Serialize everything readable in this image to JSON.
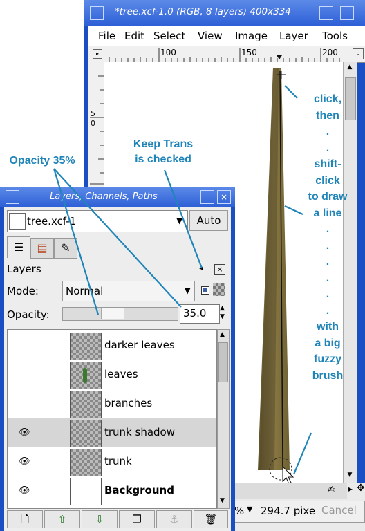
{
  "image_window": {
    "title": "*tree.xcf-1.0 (RGB, 8 layers) 400x334",
    "menu": [
      "File",
      "Edit",
      "Select",
      "View",
      "Image",
      "Layer",
      "Tools"
    ],
    "ruler_labels": [
      "100",
      "150",
      "200"
    ],
    "vruler_labels": [
      "5",
      "0"
    ],
    "zoom_value": "%",
    "coord_readout": "294.7 pixe",
    "cancel_label": "Cancel"
  },
  "layers_dialog": {
    "title": "Layers, Channels, Paths",
    "image_select": "tree.xcf-1",
    "auto_label": "Auto",
    "section_label": "Layers",
    "mode_label": "Mode:",
    "mode_value": "Normal",
    "opacity_label": "Opacity:",
    "opacity_value": "35.0",
    "opacity_fraction": 0.35,
    "keep_trans_checked": true,
    "layers": [
      {
        "name": "darker leaves",
        "visible": false,
        "selected": false,
        "bold": false
      },
      {
        "name": "leaves",
        "visible": false,
        "selected": false,
        "bold": false
      },
      {
        "name": "branches",
        "visible": false,
        "selected": false,
        "bold": false
      },
      {
        "name": "trunk shadow",
        "visible": true,
        "selected": true,
        "bold": false
      },
      {
        "name": "trunk",
        "visible": true,
        "selected": false,
        "bold": false
      },
      {
        "name": "Background",
        "visible": true,
        "selected": false,
        "bold": true
      }
    ],
    "buttons": [
      "new-layer-icon",
      "raise-icon",
      "lower-icon",
      "duplicate-icon",
      "anchor-icon",
      "delete-icon"
    ]
  },
  "annotations": {
    "opacity": "Opacity 35%",
    "keep_trans_1": "Keep Trans",
    "keep_trans_2": "is checked",
    "click_lines": [
      "click,",
      "then",
      ".",
      ".",
      "shift-",
      "click",
      "to draw",
      "a line",
      ".",
      ".",
      ".",
      ".",
      ".",
      ".",
      "with",
      "a big",
      "fuzzy",
      "brush"
    ]
  },
  "colors": {
    "titlebar": "#2d5fd6",
    "annotation": "#1f84b8",
    "trunk": "#7a6a3a",
    "selected_row": "#d6d6d6"
  }
}
